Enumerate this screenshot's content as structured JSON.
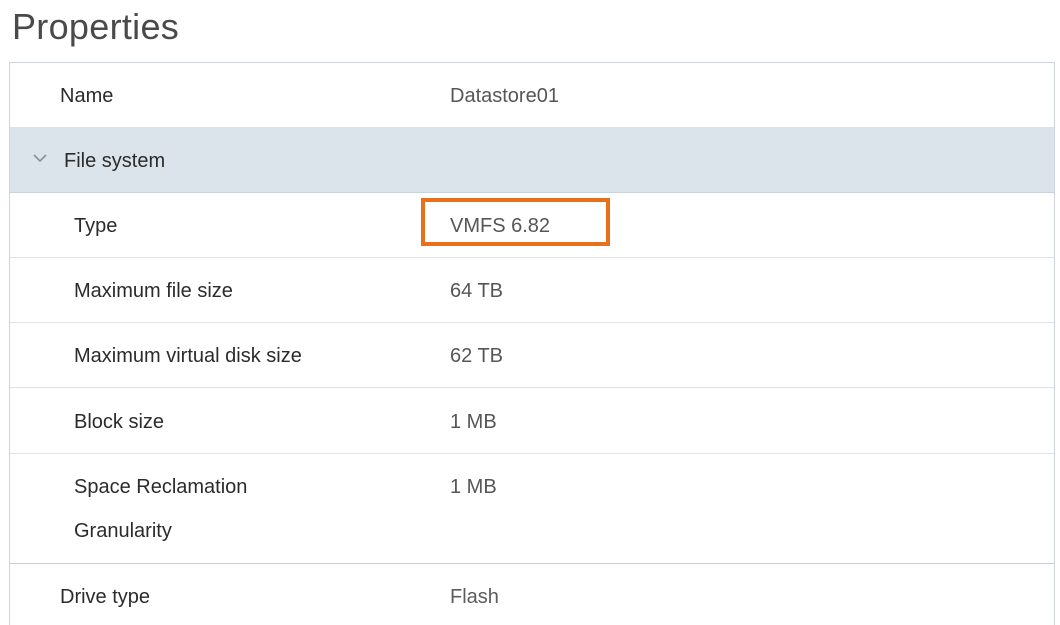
{
  "title": "Properties",
  "rows": {
    "name": {
      "label": "Name",
      "value": "Datastore01"
    },
    "file_system": {
      "label": "File system"
    },
    "type": {
      "label": "Type",
      "value": "VMFS 6.82"
    },
    "max_file_size": {
      "label": "Maximum file size",
      "value": "64 TB"
    },
    "max_vdisk_size": {
      "label": "Maximum virtual disk size",
      "value": "62 TB"
    },
    "block_size": {
      "label": "Block size",
      "value": "1 MB"
    },
    "space_reclamation": {
      "label_line1": "Space Reclamation",
      "label_line2": "Granularity",
      "value": "1 MB"
    },
    "drive_type": {
      "label": "Drive type",
      "value": "Flash"
    }
  },
  "highlight_color": "#e8701a"
}
